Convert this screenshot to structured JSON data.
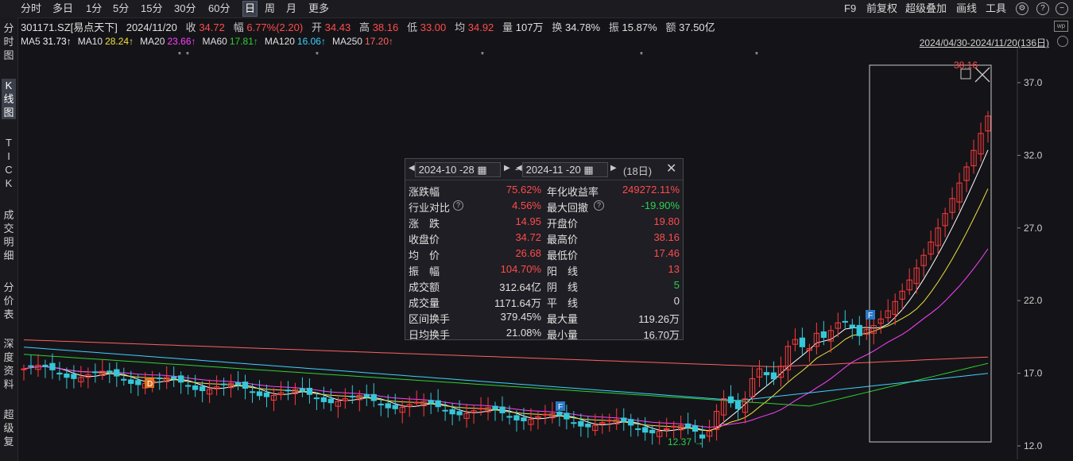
{
  "toolbar": {
    "periods": [
      "分时",
      "多日",
      "1分",
      "5分",
      "15分",
      "30分",
      "60分",
      "日",
      "周",
      "月",
      "更多"
    ],
    "active_period": "日",
    "right_items": [
      "F9",
      "前复权",
      "超级叠加",
      "画线",
      "工具"
    ],
    "icons": [
      "gear-icon",
      "help-icon",
      "minimize-icon"
    ]
  },
  "sidebar": {
    "items": [
      "分时图",
      "K线图",
      "TICK",
      "成交明细",
      "分价表",
      "深度资料",
      "超级复盘"
    ],
    "active": "K线图"
  },
  "quote": {
    "code_name": "301171.SZ[易点天下]",
    "date": "2024/11/20",
    "close_label": "收",
    "close": "34.72",
    "change_label": "幅",
    "change": "6.77%(2.20)",
    "open_label": "开",
    "open": "34.43",
    "high_label": "高",
    "high": "38.16",
    "low_label": "低",
    "low": "33.00",
    "avg_label": "均",
    "avg": "34.92",
    "vol_label": "量",
    "vol": "107万",
    "turnover_label": "换",
    "turnover": "34.78%",
    "amp_label": "振",
    "amp": "15.87%",
    "amount_label": "额",
    "amount": "37.50亿"
  },
  "ma": [
    {
      "label": "MA5",
      "value": "31.73↑",
      "color": "#ffffff"
    },
    {
      "label": "MA10",
      "value": "28.24↑",
      "color": "#f0e040"
    },
    {
      "label": "MA20",
      "value": "23.66↑",
      "color": "#ff40ff"
    },
    {
      "label": "MA60",
      "value": "17.81↑",
      "color": "#30d030"
    },
    {
      "label": "MA120",
      "value": "16.06↑",
      "color": "#40d0ff"
    },
    {
      "label": "MA250",
      "value": "17.20↑",
      "color": "#ff6060"
    }
  ],
  "date_range": "2024/04/30-2024/11/20(136日)",
  "panel": {
    "start_date": "2024-10 -28",
    "end_date": "2024-11 -20",
    "days": "(18日)",
    "rows": [
      {
        "l1": "涨跌幅",
        "v1": "75.62%",
        "c1": "red",
        "l2": "年化收益率",
        "v2": "249272.11%",
        "c2": "red"
      },
      {
        "l1": "行业对比",
        "v1": "4.56%",
        "c1": "red",
        "l2": "最大回撤",
        "v2": "-19.90%",
        "c2": "green",
        "q1": true,
        "q2": true
      },
      {
        "l1": "涨　跌",
        "v1": "14.95",
        "c1": "red",
        "l2": "开盘价",
        "v2": "19.80",
        "c2": "red"
      },
      {
        "l1": "收盘价",
        "v1": "34.72",
        "c1": "red",
        "l2": "最高价",
        "v2": "38.16",
        "c2": "red"
      },
      {
        "l1": "均　价",
        "v1": "26.68",
        "c1": "red",
        "l2": "最低价",
        "v2": "17.46",
        "c2": "red"
      },
      {
        "l1": "振　幅",
        "v1": "104.70%",
        "c1": "red",
        "l2": "阳　线",
        "v2": "13",
        "c2": "red"
      },
      {
        "l1": "成交额",
        "v1": "312.64亿",
        "c1": "white",
        "l2": "阴　线",
        "v2": "5",
        "c2": "green"
      },
      {
        "l1": "成交量",
        "v1": "1171.64万",
        "c1": "white",
        "l2": "平　线",
        "v2": "0",
        "c2": "white"
      },
      {
        "l1": "区间换手",
        "v1": "379.45%",
        "c1": "white",
        "l2": "最大量",
        "v2": "119.26万",
        "c2": "white"
      },
      {
        "l1": "日均换手",
        "v1": "21.08%",
        "c1": "white",
        "l2": "最小量",
        "v2": "16.70万",
        "c2": "white"
      }
    ]
  },
  "chart_data": {
    "type": "candlestick",
    "y_ticks": [
      "37.0",
      "32.0",
      "27.0",
      "22.0",
      "17.0",
      "12.0"
    ],
    "ylim": [
      12.0,
      38.16
    ],
    "low_label": "12.37",
    "high_label": "38.16",
    "markers": [
      "D",
      "F",
      "F"
    ],
    "ma_lines": [
      "MA5",
      "MA10",
      "MA20",
      "MA60",
      "MA120",
      "MA250"
    ]
  },
  "colors": {
    "up": "#ff3b3b",
    "down": "#35c8d8",
    "bg": "#141418"
  }
}
